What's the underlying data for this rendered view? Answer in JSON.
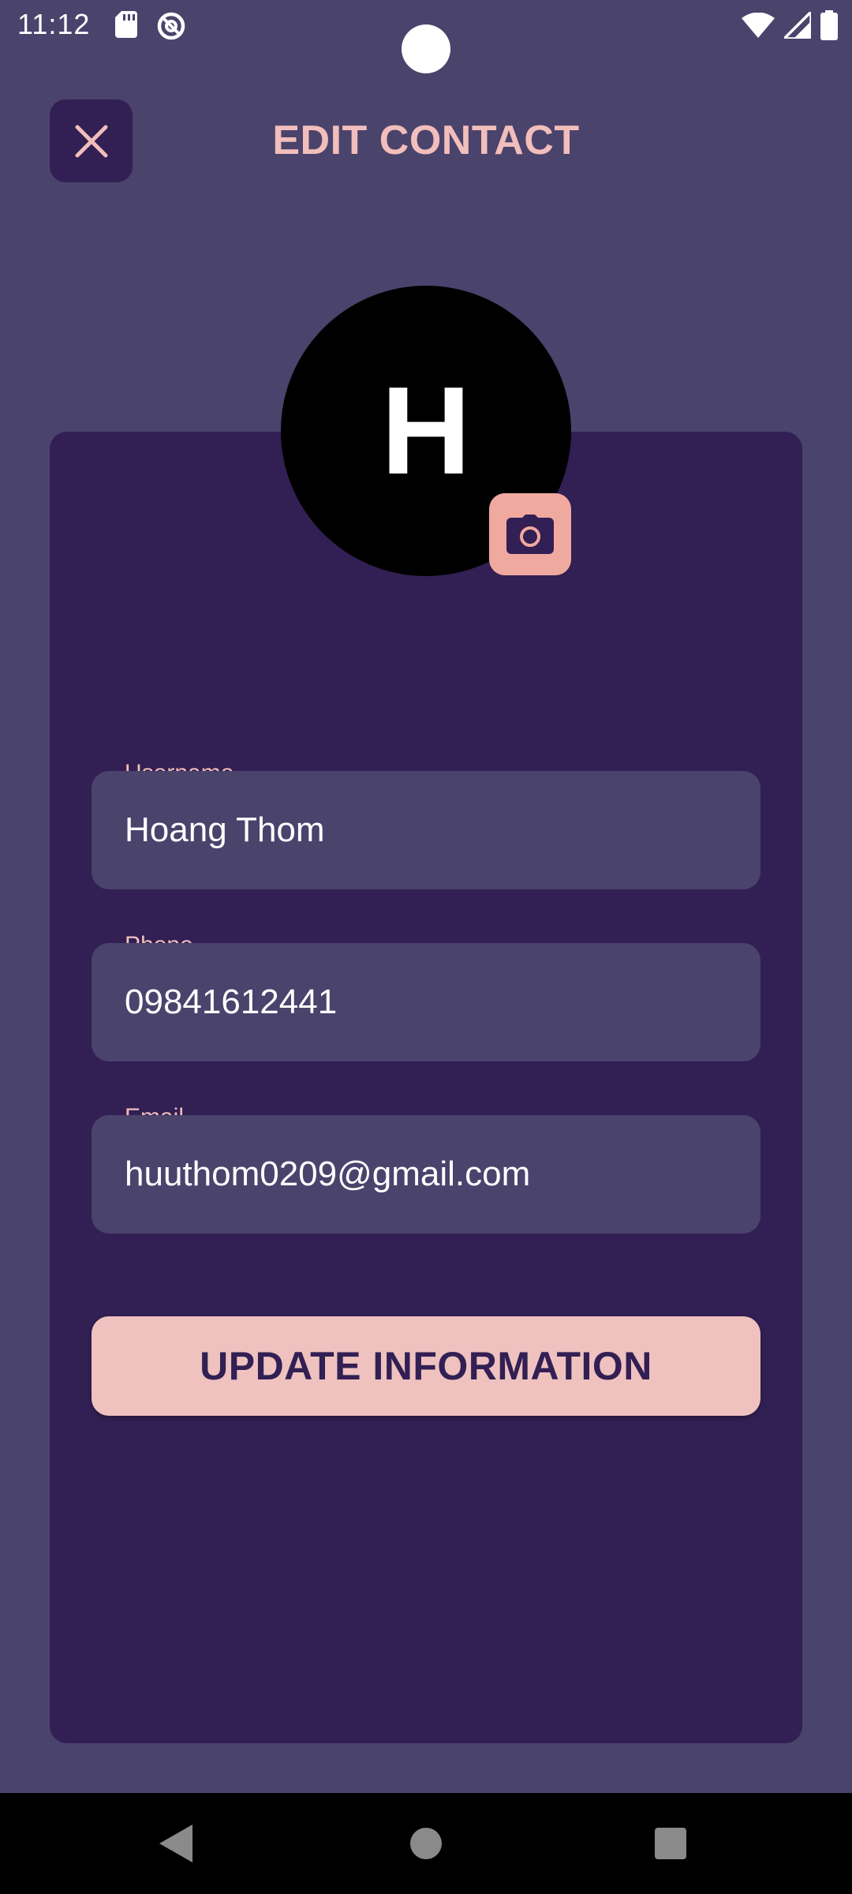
{
  "status_bar": {
    "time": "11:12",
    "icons": [
      "sd-card-icon",
      "do-not-disturb-icon",
      "wifi-icon",
      "signal-icon",
      "battery-icon"
    ]
  },
  "header": {
    "title": "EDIT CONTACT",
    "close_icon": "close-icon"
  },
  "avatar": {
    "initial": "H",
    "photo_icon": "camera-icon"
  },
  "form": {
    "username": {
      "label": "Username",
      "value": "Hoang Thom"
    },
    "phone": {
      "label": "Phone",
      "value": "09841612441"
    },
    "email": {
      "label": "Email",
      "value": "huuthom0209@gmail.com"
    }
  },
  "actions": {
    "update_label": "UPDATE INFORMATION"
  },
  "nav": {
    "icons": [
      "back-icon",
      "home-icon",
      "recents-icon"
    ]
  },
  "colors": {
    "background": "#4a436c",
    "card": "#321f53",
    "accent": "#f2bebb",
    "button": "#efc2bf",
    "photo_button": "#f0a99f"
  }
}
